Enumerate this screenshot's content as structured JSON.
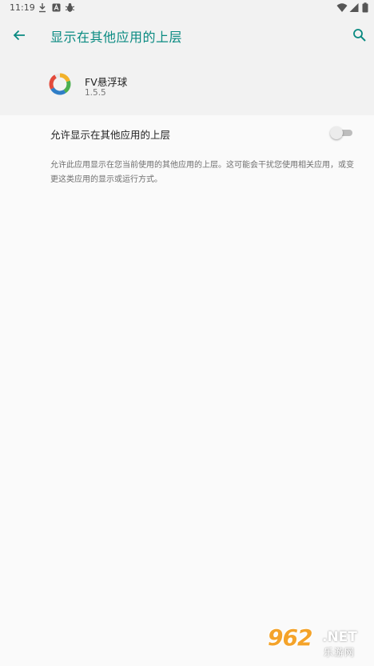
{
  "status_bar": {
    "time": "11:19",
    "icons": [
      "download-icon",
      "a-badge-icon",
      "bug-icon",
      "wifi-icon",
      "signal-icon",
      "battery-icon"
    ]
  },
  "toolbar": {
    "title": "显示在其他应用的上层",
    "back_icon": "arrow-back-icon",
    "search_icon": "search-icon"
  },
  "app": {
    "name": "FV悬浮球",
    "version": "1.5.5"
  },
  "setting": {
    "label": "允许显示在其他应用的上层",
    "enabled": false
  },
  "description": "允许此应用显示在您当前使用的其他应用的上层。这可能会干扰您使用相关应用，或变更这类应用的显示或运行方式。",
  "watermark": {
    "main": "962",
    "suffix": ".NET",
    "sub": "乐游网"
  },
  "colors": {
    "accent": "#098a81",
    "background": "#fafafa",
    "header_background": "#f2f2f2",
    "watermark": "#f4a32a"
  }
}
